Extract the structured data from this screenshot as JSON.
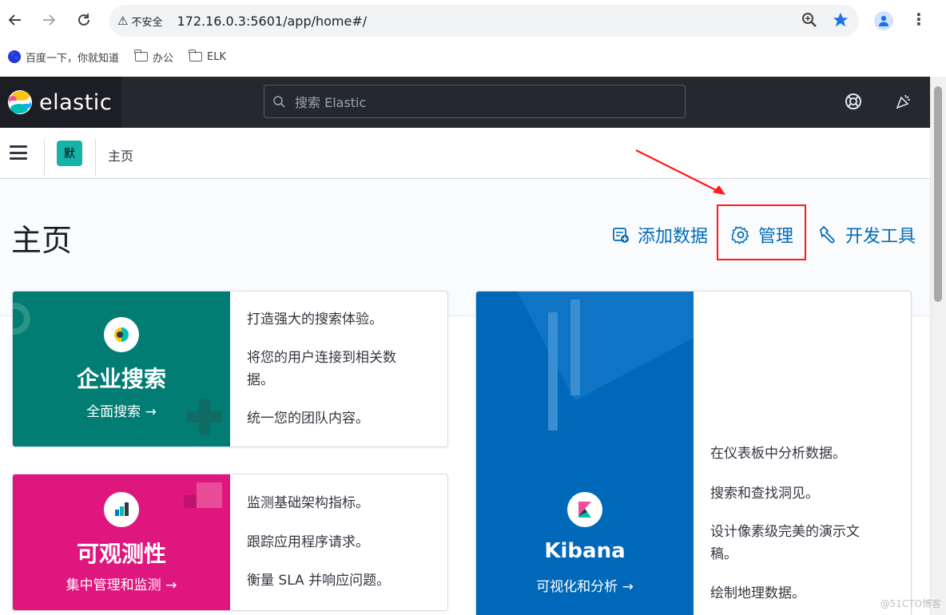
{
  "browser": {
    "security_label": "不安全",
    "url": "172.16.0.3:5601/app/home#/",
    "bookmarks": [
      {
        "label": "百度一下，你就知道",
        "icon": "baidu-icon"
      },
      {
        "label": "办公",
        "icon": "folder-icon"
      },
      {
        "label": "ELK",
        "icon": "folder-icon"
      }
    ]
  },
  "header": {
    "brand": "elastic",
    "search_placeholder": "搜索 Elastic"
  },
  "breadcrumb": {
    "space_initial": "默",
    "current": "主页"
  },
  "page": {
    "title": "主页",
    "actions": {
      "add_data": "添加数据",
      "management": "管理",
      "dev_tools": "开发工具"
    }
  },
  "cards": {
    "enterprise_search": {
      "title": "企业搜索",
      "link": "全面搜索 →",
      "lines": [
        "打造强大的搜索体验。",
        "将您的用户连接到相关数",
        "据。",
        "统一您的团队内容。"
      ]
    },
    "observability": {
      "title": "可观测性",
      "link": "集中管理和监测 →",
      "lines": [
        "监测基础架构指标。",
        "跟踪应用程序请求。",
        "衡量 SLA 并响应问题。"
      ]
    },
    "kibana": {
      "title": "Kibana",
      "link": "可视化和分析 →",
      "lines": [
        "在仪表板中分析数据。",
        "搜索和查找洞见。",
        "设计像素级完美的演示文",
        "稿。",
        "绘制地理数据。"
      ]
    }
  },
  "watermark": "@51CTO博客",
  "colors": {
    "enterprise": "#017d73",
    "observability": "#e0167f",
    "kibana": "#0068b8",
    "link": "#006bb8",
    "highlight": "#ff1a1a"
  }
}
